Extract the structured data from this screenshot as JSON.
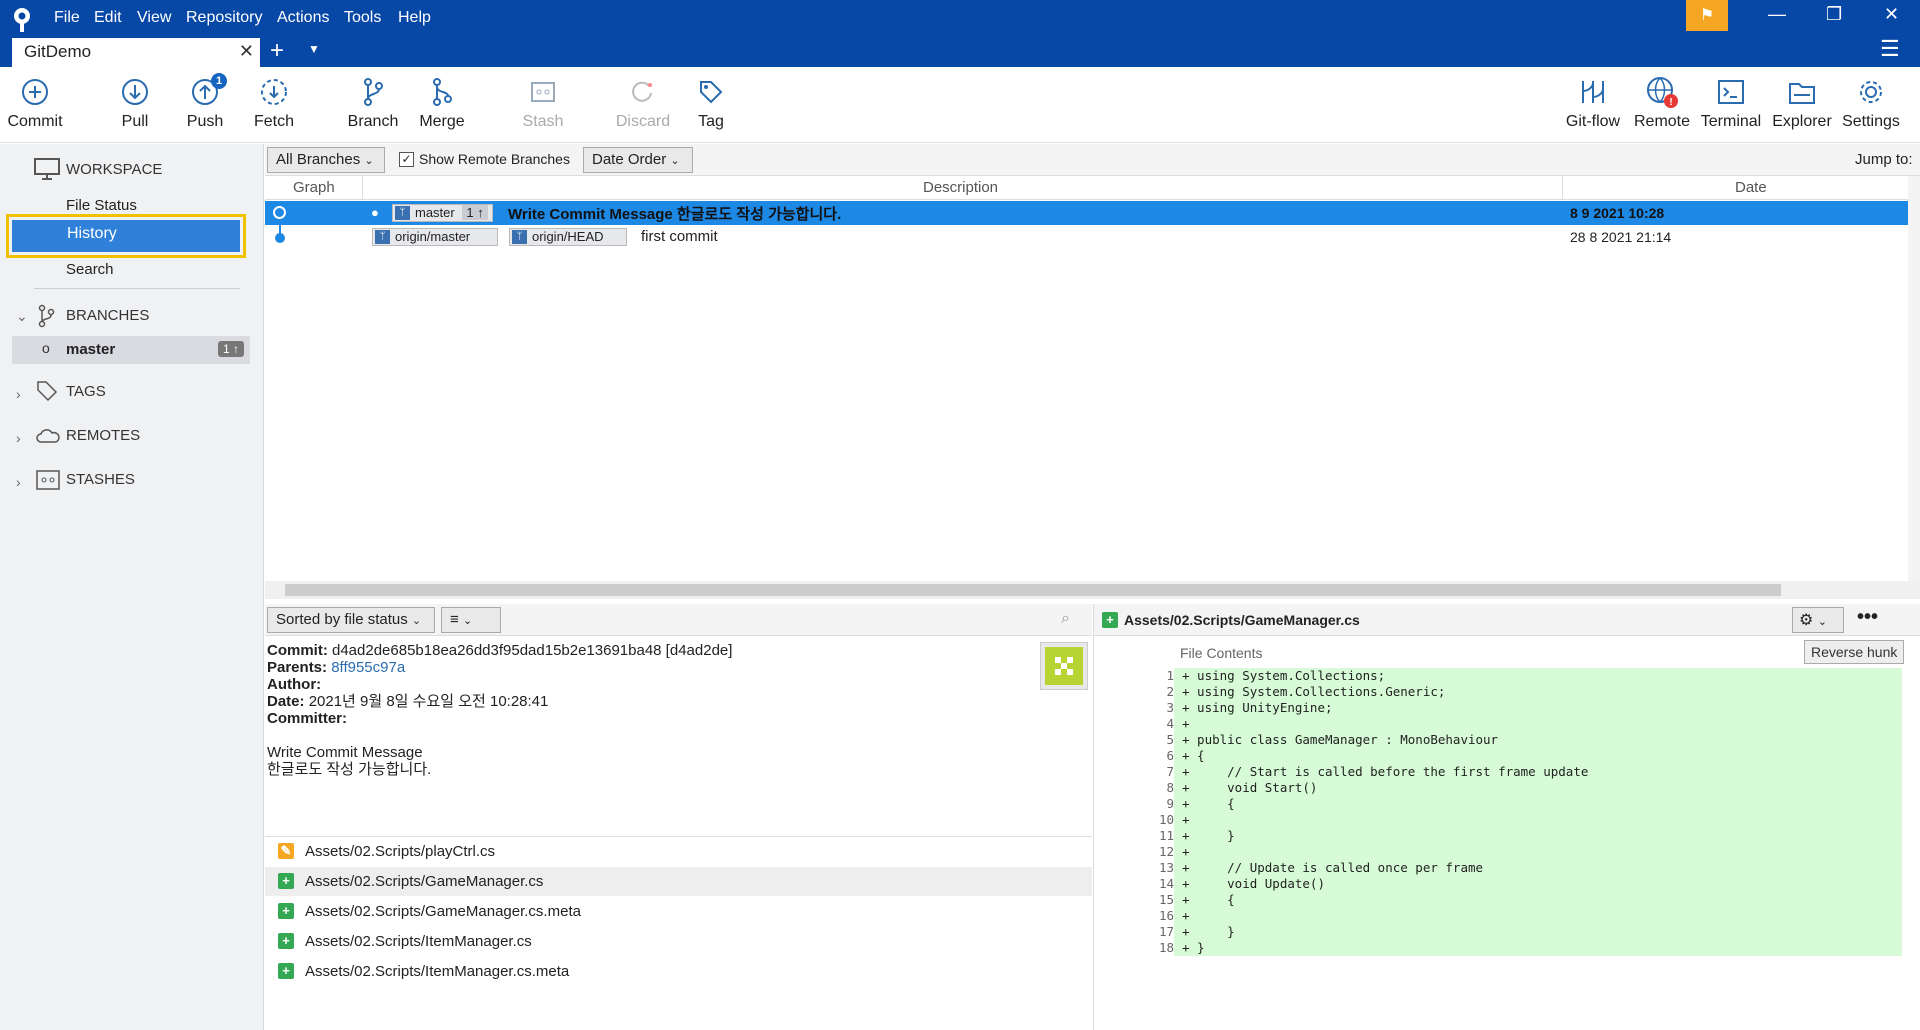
{
  "app": {
    "menu": [
      "File",
      "Edit",
      "View",
      "Repository",
      "Actions",
      "Tools",
      "Help"
    ],
    "tab_title": "GitDemo",
    "accent": "#0747a6"
  },
  "toolbar": {
    "commit": "Commit",
    "pull": "Pull",
    "push": "Push",
    "push_badge": "1",
    "fetch": "Fetch",
    "branch": "Branch",
    "merge": "Merge",
    "stash": "Stash",
    "discard": "Discard",
    "tag": "Tag",
    "gitflow": "Git-flow",
    "remote": "Remote",
    "terminal": "Terminal",
    "explorer": "Explorer",
    "settings": "Settings"
  },
  "sidebar": {
    "workspace": "WORKSPACE",
    "file_status": "File Status",
    "history": "History",
    "search": "Search",
    "branches": "BRANCHES",
    "master": "master",
    "master_badge": "1 ↑",
    "tags": "TAGS",
    "remotes": "REMOTES",
    "stashes": "STASHES"
  },
  "filters": {
    "branches": "All Branches",
    "show_remote": "Show Remote Branches",
    "order": "Date Order",
    "jump_to": "Jump to:"
  },
  "log": {
    "col_graph": "Graph",
    "col_description": "Description",
    "col_date": "Date",
    "rows": [
      {
        "ref1": "master",
        "ref1_badge": "1 ↑",
        "message": "Write Commit Message 한글로도 작성 가능합니다.",
        "date": "8 9 2021 10:28"
      },
      {
        "ref1": "origin/master",
        "ref2": "origin/HEAD",
        "message": "first commit",
        "date": "28 8 2021 21:14"
      }
    ]
  },
  "lower": {
    "sort": "Sorted by file status",
    "commit_label": "Commit:",
    "commit_value": "d4ad2de685b18ea26dd3f95dad15b2e13691ba48 [d4ad2de]",
    "parents_label": "Parents:",
    "parents_value": "8ff955c97a",
    "author_label": "Author:",
    "date_label": "Date:",
    "date_value": "2021년 9월 8일 수요일 오전 10:28:41",
    "committer_label": "Committer:",
    "msg1": "Write Commit Message",
    "msg2": "한글로도 작성 가능합니다.",
    "files": [
      {
        "name": "Assets/02.Scripts/playCtrl.cs",
        "status": "modified"
      },
      {
        "name": "Assets/02.Scripts/GameManager.cs",
        "status": "added"
      },
      {
        "name": "Assets/02.Scripts/GameManager.cs.meta",
        "status": "added"
      },
      {
        "name": "Assets/02.Scripts/ItemManager.cs",
        "status": "added"
      },
      {
        "name": "Assets/02.Scripts/ItemManager.cs.meta",
        "status": "added"
      }
    ]
  },
  "diff": {
    "file": "Assets/02.Scripts/GameManager.cs",
    "sub": "File Contents",
    "reverse": "Reverse hunk",
    "lines": [
      "+ using System.Collections;",
      "+ using System.Collections.Generic;",
      "+ using UnityEngine;",
      "+",
      "+ public class GameManager : MonoBehaviour",
      "+ {",
      "+     // Start is called before the first frame update",
      "+     void Start()",
      "+     {",
      "+ ",
      "+     }",
      "+",
      "+     // Update is called once per frame",
      "+     void Update()",
      "+     {",
      "+ ",
      "+     }",
      "+ }"
    ]
  }
}
